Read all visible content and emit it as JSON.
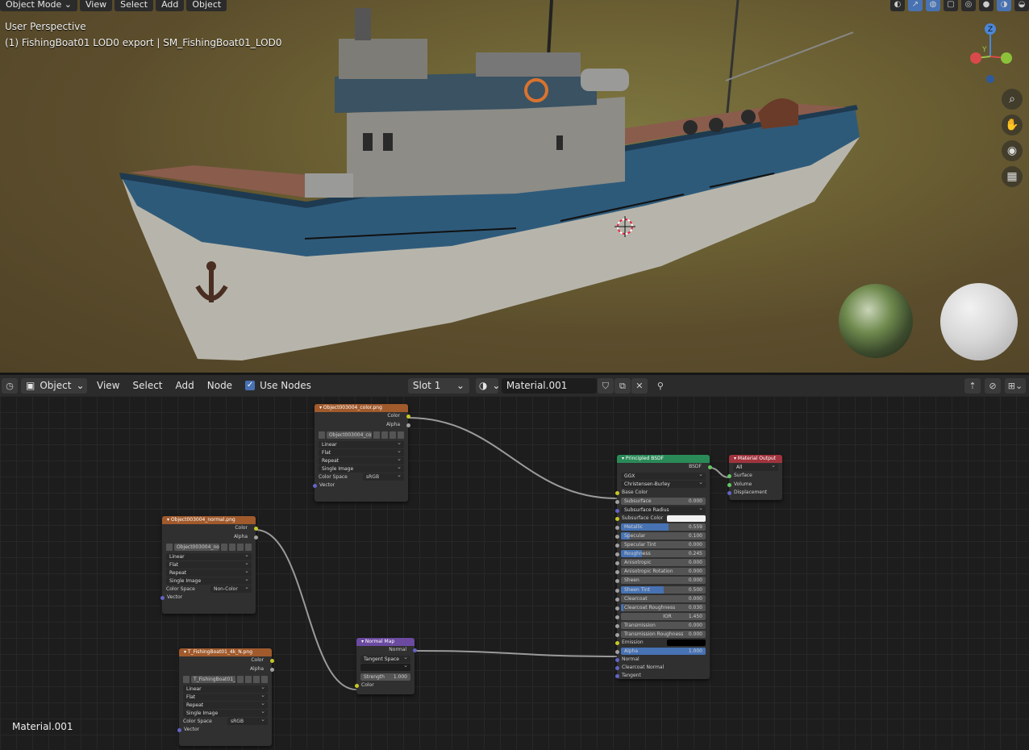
{
  "viewport": {
    "header": {
      "mode": "Object Mode",
      "menus": [
        "View",
        "Select",
        "Add",
        "Object"
      ]
    },
    "perspective": "User Perspective",
    "object_info": "(1) FishingBoat01 LOD0 export | SM_FishingBoat01_LOD0",
    "gizmo_axes": {
      "z": "Z",
      "y": "Y",
      "x": "X"
    },
    "tool_icons": [
      "zoom-icon",
      "hand-icon",
      "camera-icon",
      "grid-icon"
    ],
    "colors": {
      "hull_blue": "#2e5a7a",
      "hull_white": "#b7b5ab",
      "accent": "#4772b3"
    }
  },
  "node_header": {
    "editor_type": "Object",
    "menus": [
      "View",
      "Select",
      "Add",
      "Node"
    ],
    "use_nodes_label": "Use Nodes",
    "slot": "Slot 1",
    "material": "Material.001"
  },
  "nodes": {
    "color_tex": {
      "title": "Object003004_color.png",
      "outputs": [
        "Color",
        "Alpha"
      ],
      "image": "Object003004_col...",
      "interpolation": "Linear",
      "projection": "Flat",
      "extension": "Repeat",
      "source": "Single Image",
      "colorspace_label": "Color Space",
      "colorspace": "sRGB",
      "input": "Vector"
    },
    "normal_tex": {
      "title": "Object003004_normal.png",
      "outputs": [
        "Color",
        "Alpha"
      ],
      "image": "Object003004_no...",
      "interpolation": "Linear",
      "projection": "Flat",
      "extension": "Repeat",
      "source": "Single Image",
      "colorspace_label": "Color Space",
      "colorspace": "Non-Color",
      "input": "Vector"
    },
    "n_tex": {
      "title": "T_FishingBoat01_4k_N.png",
      "outputs": [
        "Color",
        "Alpha"
      ],
      "image": "T_FishingBoat01_...",
      "interpolation": "Linear",
      "projection": "Flat",
      "extension": "Repeat",
      "source": "Single Image",
      "colorspace_label": "Color Space",
      "colorspace": "sRGB",
      "input": "Vector"
    },
    "normal_map": {
      "title": "Normal Map",
      "output": "Normal",
      "space": "Tangent Space",
      "uv": "",
      "strength_label": "Strength",
      "strength": "1.000",
      "input": "Color"
    },
    "bsdf": {
      "title": "Principled BSDF",
      "output": "BSDF",
      "distribution": "GGX",
      "subsurface_method": "Christensen-Burley",
      "base_color": "Base Color",
      "subsurface": {
        "label": "Subsurface",
        "value": "0.000",
        "fill": 0
      },
      "subsurface_radius": "Subsurface Radius",
      "subsurface_color": "Subsurface Color",
      "metallic": {
        "label": "Metallic",
        "value": "0.559",
        "fill": 0.559
      },
      "specular": {
        "label": "Specular",
        "value": "0.100",
        "fill": 0.1
      },
      "specular_tint": {
        "label": "Specular Tint",
        "value": "0.000",
        "fill": 0
      },
      "roughness": {
        "label": "Roughness",
        "value": "0.245",
        "fill": 0.245
      },
      "anisotropic": {
        "label": "Anisotropic",
        "value": "0.000",
        "fill": 0
      },
      "anisotropic_rotation": {
        "label": "Anisotropic Rotation",
        "value": "0.000",
        "fill": 0
      },
      "sheen": {
        "label": "Sheen",
        "value": "0.000",
        "fill": 0
      },
      "sheen_tint": {
        "label": "Sheen Tint",
        "value": "0.500",
        "fill": 0.5
      },
      "clearcoat": {
        "label": "Clearcoat",
        "value": "0.000",
        "fill": 0
      },
      "clearcoat_roughness": {
        "label": "Clearcoat Roughness",
        "value": "0.030",
        "fill": 0.03
      },
      "ior": {
        "label": "IOR",
        "value": "1.450"
      },
      "transmission": {
        "label": "Transmission",
        "value": "0.000",
        "fill": 0
      },
      "transmission_roughness": {
        "label": "Transmission Roughness",
        "value": "0.000",
        "fill": 0
      },
      "emission": "Emission",
      "alpha": {
        "label": "Alpha",
        "value": "1.000",
        "fill": 1
      },
      "normal": "Normal",
      "clearcoat_normal": "Clearcoat Normal",
      "tangent": "Tangent"
    },
    "output": {
      "title": "Material Output",
      "target": "All",
      "inputs": [
        "Surface",
        "Volume",
        "Displacement"
      ]
    }
  },
  "footer_material": "Material.001"
}
